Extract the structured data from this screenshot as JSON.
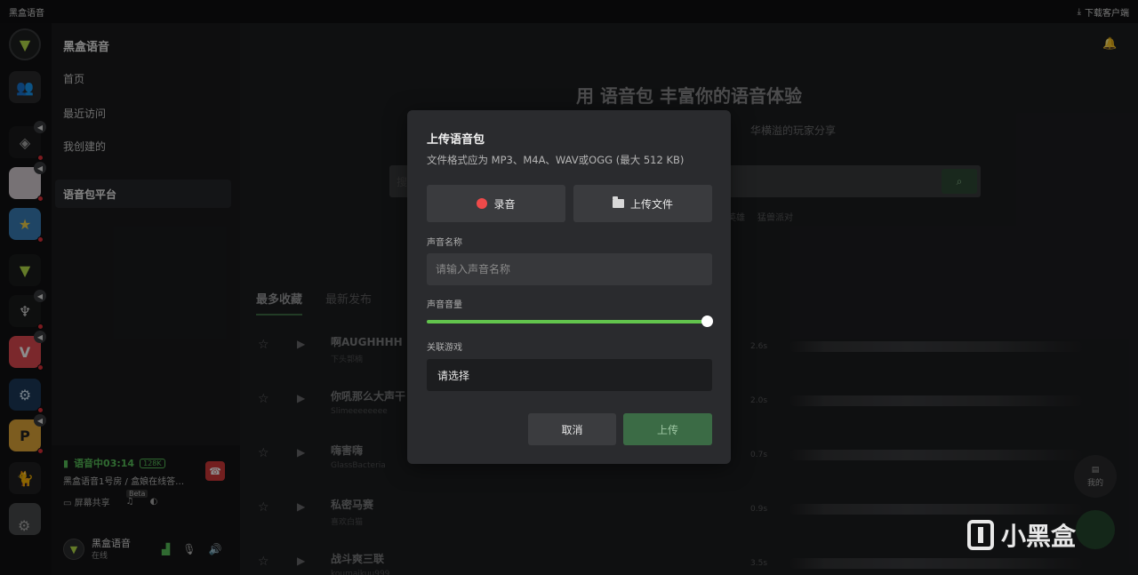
{
  "window": {
    "title": "黑盒语音",
    "download_label": "下载客户端",
    "download_icon": "download-icon"
  },
  "rail": {
    "items": [
      {
        "icon": "heybox-logo-icon",
        "color": "#b6e04a"
      },
      {
        "icon": "friends-icon",
        "color": "#c8a94a"
      },
      {
        "icon": "server-icon"
      },
      {
        "icon": "anime-server-icon"
      },
      {
        "icon": "game-server-icon"
      },
      {
        "icon": "heybox-server-icon"
      },
      {
        "icon": "destiny-server-icon"
      },
      {
        "icon": "valorant-server-icon"
      },
      {
        "icon": "steam-icon"
      },
      {
        "icon": "pubg-icon"
      },
      {
        "icon": "cat-server-icon"
      },
      {
        "icon": "misc-server-icon"
      }
    ],
    "settings_icon": "gear-icon"
  },
  "sidebar": {
    "title": "黑盒语音",
    "items": [
      {
        "label": "首页"
      },
      {
        "label": "最近访问"
      },
      {
        "label": "我创建的"
      }
    ],
    "active_item": "语音包平台"
  },
  "voice": {
    "status": "语音中03:14",
    "quality": "128K",
    "room": "黑盒语音1号房 / 盒娘在线答…",
    "tools": {
      "screen_share": "屏幕共享",
      "beta": "Beta"
    }
  },
  "user": {
    "name": "黑盒语音",
    "status": "在线"
  },
  "main": {
    "hero": "用 语音包 丰富你的语音体验",
    "subtitle": "华横溢的玩家分享",
    "search_placeholder": "搜",
    "tags": [
      "英雄",
      "猛兽派对"
    ],
    "tabs": [
      "最多收藏",
      "最新发布"
    ],
    "rows": [
      {
        "name": "啊AUGHHHH",
        "author": "下头郭楠",
        "duration": "2.6s"
      },
      {
        "name": "你吼那么大声干",
        "author": "Slimeeeeeeee",
        "duration": "2.0s"
      },
      {
        "name": "嗨害嗨",
        "author": "GlassBacteria",
        "duration": "0.7s"
      },
      {
        "name": "私密马赛",
        "author": "喜欢白猫",
        "duration": "0.9s"
      },
      {
        "name": "战斗爽三联",
        "author": "koumaikuu999",
        "duration": "3.5s"
      }
    ],
    "my_button": "我的"
  },
  "modal": {
    "title": "上传语音包",
    "subtitle": "文件格式应为 MP3、M4A、WAV或OGG (最大 512 KB)",
    "record_label": "录音",
    "upload_file_label": "上传文件",
    "name_label": "声音名称",
    "name_placeholder": "请输入声音名称",
    "volume_label": "声音音量",
    "volume": 1.0,
    "game_label": "关联游戏",
    "game_value": "请选择",
    "cancel_label": "取消",
    "upload_label": "上传",
    "accent_color": "#62c44d"
  },
  "watermark": {
    "text": "小黑盒"
  }
}
